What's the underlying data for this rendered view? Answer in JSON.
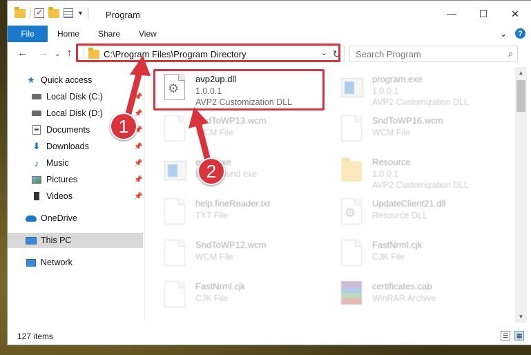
{
  "window": {
    "title": "Program",
    "minimize": "—",
    "maximize": "☐",
    "close": "✕"
  },
  "ribbon": {
    "file": "File",
    "home": "Home",
    "share": "Share",
    "view": "View",
    "expand": "⌄",
    "help": "?"
  },
  "address": {
    "path": "C:\\Program Files\\Program Directory",
    "search_placeholder": "Search Program"
  },
  "sidebar": {
    "items": [
      {
        "label": "Quick access"
      },
      {
        "label": "Local Disk (C:)"
      },
      {
        "label": "Local Disk (D:)"
      },
      {
        "label": "Documents"
      },
      {
        "label": "Downloads"
      },
      {
        "label": "Music"
      },
      {
        "label": "Pictures"
      },
      {
        "label": "Videos"
      },
      {
        "label": "OneDrive"
      },
      {
        "label": "This PC"
      },
      {
        "label": "Network"
      }
    ]
  },
  "files": [
    {
      "name": "avp2up.dll",
      "line1": "1.0.0.1",
      "line2": "AVP2 Customization DLL",
      "icon": "dll-gear-icon"
    },
    {
      "name": "program.exe",
      "line1": "1.0.0.1",
      "line2": "AVP2 Customization DLL",
      "icon": "exe-icon"
    },
    {
      "name": "SndToWP13.wcm",
      "line1": "WCM File",
      "line2": "",
      "icon": "file-icon"
    },
    {
      "name": "SndToWP16.wcm",
      "line1": "WCM File",
      "line2": "",
      "icon": "file-icon"
    },
    {
      "name": "exec.exe",
      "line1": "background exe",
      "line2": "",
      "icon": "exe-icon"
    },
    {
      "name": "Resource",
      "line1": "1.0.0.1",
      "line2": "AVP2 Customization DLL",
      "icon": "folder-icon"
    },
    {
      "name": "help.fineReader.txt",
      "line1": "TXT File",
      "line2": "",
      "icon": "file-icon"
    },
    {
      "name": "UpdateClient21.dll",
      "line1": "Resource DLL",
      "line2": "",
      "icon": "dll-gear-icon"
    },
    {
      "name": "SndToWP12.wcm",
      "line1": "WCM File",
      "line2": "",
      "icon": "file-icon"
    },
    {
      "name": "FastNrml.cjk",
      "line1": "CJK File",
      "line2": "",
      "icon": "file-icon"
    },
    {
      "name": "FastNrml.cjk",
      "line1": "CJK File",
      "line2": "",
      "icon": "file-icon"
    },
    {
      "name": "certificates.cab",
      "line1": "WinRAR Archive",
      "line2": "",
      "icon": "winrar-icon"
    }
  ],
  "status": {
    "count": "127 items"
  },
  "annotations": {
    "step1": "1",
    "step2": "2",
    "accent": "#d9343d"
  }
}
